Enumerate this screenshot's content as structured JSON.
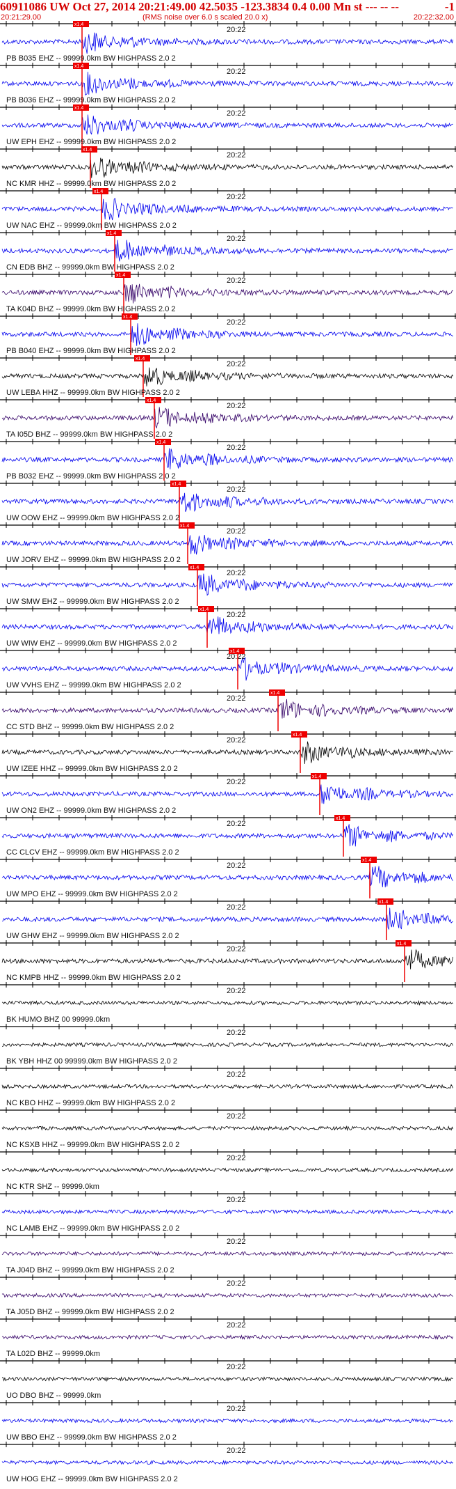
{
  "header": {
    "title": "60911086 UW Oct 27, 2014 20:21:49.00   42.5035 -123.3834  0.4 0.00 Mn st --- -- --",
    "title_right": "-1",
    "start_time": "20:21:29.00",
    "note": "(RMS noise over 6.0 s scaled 20.0 x)",
    "end_time": "20:22:32.00",
    "color": "#d40000"
  },
  "minute_label": "20:22",
  "pick_label": "x1.4",
  "colors": {
    "black": "#000000",
    "blue": "#0000ee",
    "purple": "#330066",
    "pick": "#ee0000"
  },
  "traces": [
    {
      "label": "PB B035 EHZ -- 99999.0km BW  HIGHPASS  2.0  2",
      "color": "blue",
      "pick": true
    },
    {
      "label": "PB B036 EHZ -- 99999.0km BW  HIGHPASS  2.0  2",
      "color": "blue",
      "pick": true
    },
    {
      "label": "UW EPH EHZ -- 99999.0km BW  HIGHPASS  2.0  2",
      "color": "blue",
      "pick": true
    },
    {
      "label": "NC KMR HHZ -- 99999.0km BW  HIGHPASS  2.0  2",
      "color": "black",
      "pick": true
    },
    {
      "label": "UW NAC EHZ -- 99999.0km BW  HIGHPASS  2.0  2",
      "color": "blue",
      "pick": true
    },
    {
      "label": "CN EDB BHZ -- 99999.0km BW  HIGHPASS  2.0  2",
      "color": "blue",
      "pick": true
    },
    {
      "label": "TA K04D BHZ -- 99999.0km BW  HIGHPASS  2.0  2",
      "color": "purple",
      "pick": true
    },
    {
      "label": "PB B040 EHZ -- 99999.0km BW  HIGHPASS  2.0  2",
      "color": "blue",
      "pick": true
    },
    {
      "label": "UW LEBA HHZ -- 99999.0km BW  HIGHPASS  2.0  2",
      "color": "black",
      "pick": true
    },
    {
      "label": "TA I05D BHZ -- 99999.0km BW  HIGHPASS  2.0  2",
      "color": "purple",
      "pick": true
    },
    {
      "label": "PB B032 EHZ -- 99999.0km BW  HIGHPASS  2.0  2",
      "color": "blue",
      "pick": true
    },
    {
      "label": "UW OOW EHZ -- 99999.0km BW  HIGHPASS  2.0  2",
      "color": "blue",
      "pick": true
    },
    {
      "label": "UW JORV EHZ -- 99999.0km BW  HIGHPASS  2.0  2",
      "color": "blue",
      "pick": true
    },
    {
      "label": "UW SMW EHZ -- 99999.0km BW  HIGHPASS  2.0  2",
      "color": "blue",
      "pick": true
    },
    {
      "label": "UW WIW EHZ -- 99999.0km BW  HIGHPASS  2.0  2",
      "color": "blue",
      "pick": true
    },
    {
      "label": "UW VVHS EHZ -- 99999.0km BW  HIGHPASS  2.0  2",
      "color": "blue",
      "pick": true
    },
    {
      "label": "CC STD BHZ -- 99999.0km BW  HIGHPASS  2.0  2",
      "color": "purple",
      "pick": true
    },
    {
      "label": "UW IZEE HHZ -- 99999.0km BW  HIGHPASS  2.0  2",
      "color": "black",
      "pick": true
    },
    {
      "label": "UW ON2 EHZ -- 99999.0km BW  HIGHPASS  2.0  2",
      "color": "blue",
      "pick": true
    },
    {
      "label": "CC CLCV EHZ -- 99999.0km BW  HIGHPASS  2.0  2",
      "color": "blue",
      "pick": true
    },
    {
      "label": "UW MPO EHZ -- 99999.0km BW  HIGHPASS  2.0  2",
      "color": "blue",
      "pick": true
    },
    {
      "label": "UW GHW EHZ -- 99999.0km BW  HIGHPASS  2.0  2",
      "color": "blue",
      "pick": true
    },
    {
      "label": "NC KMPB HHZ -- 99999.0km BW  HIGHPASS  2.0  2",
      "color": "black",
      "pick": true
    },
    {
      "label": "BK HUMO BHZ 00 99999.0km",
      "color": "black",
      "pick": false
    },
    {
      "label": "BK YBH HHZ 00 99999.0km BW  HIGHPASS  2.0  2",
      "color": "black",
      "pick": false
    },
    {
      "label": "NC KBO HHZ -- 99999.0km BW  HIGHPASS  2.0  2",
      "color": "black",
      "pick": false
    },
    {
      "label": "NC KSXB HHZ -- 99999.0km BW  HIGHPASS  2.0  2",
      "color": "black",
      "pick": false
    },
    {
      "label": "NC KTR SHZ -- 99999.0km",
      "color": "black",
      "pick": false
    },
    {
      "label": "NC LAMB EHZ -- 99999.0km BW  HIGHPASS  2.0  2",
      "color": "blue",
      "pick": false
    },
    {
      "label": "TA J04D BHZ -- 99999.0km BW  HIGHPASS  2.0  2",
      "color": "purple",
      "pick": false
    },
    {
      "label": "TA J05D BHZ -- 99999.0km BW  HIGHPASS  2.0  2",
      "color": "purple",
      "pick": false
    },
    {
      "label": "TA L02D BHZ -- 99999.0km",
      "color": "purple",
      "pick": false
    },
    {
      "label": "UO DBO BHZ -- 99999.0km",
      "color": "black",
      "pick": false
    },
    {
      "label": "UW BBO EHZ -- 99999.0km BW  HIGHPASS  2.0  2",
      "color": "blue",
      "pick": false
    },
    {
      "label": "UW HOG EHZ -- 99999.0km BW  HIGHPASS  2.0  2",
      "color": "blue",
      "pick": false
    }
  ]
}
